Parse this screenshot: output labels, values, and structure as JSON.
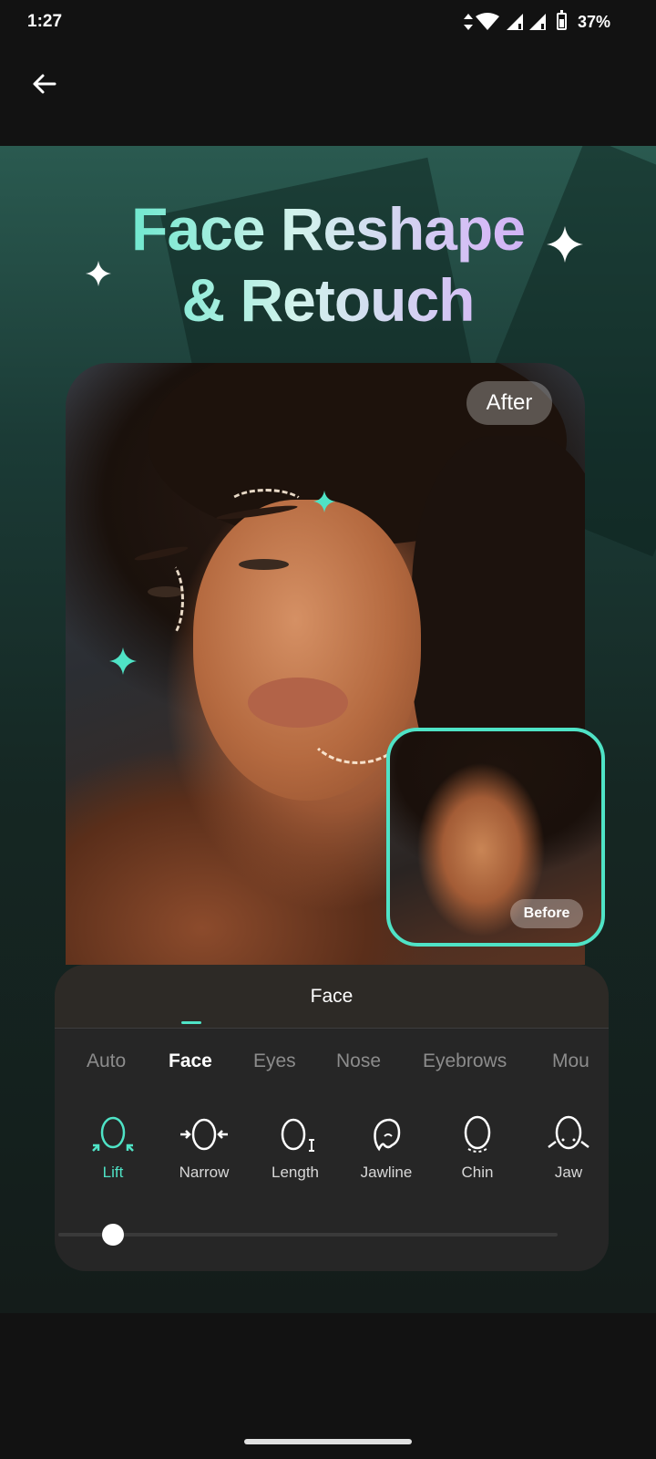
{
  "status_bar": {
    "time": "1:27",
    "battery_percent": "37%",
    "battery_level": 0.37,
    "icons": [
      "data-arrows-icon",
      "wifi-icon",
      "signal-icon",
      "signal-icon",
      "battery-icon"
    ]
  },
  "app_bar": {
    "back_icon": "arrow-left-icon"
  },
  "hero": {
    "title_line1": "Face Reshape",
    "title_line2": "& Retouch",
    "after_label": "After",
    "before_label": "Before"
  },
  "panel": {
    "header": "Face",
    "tabs": [
      {
        "label": "Auto",
        "active": false
      },
      {
        "label": "Face",
        "active": true
      },
      {
        "label": "Eyes",
        "active": false
      },
      {
        "label": "Nose",
        "active": false
      },
      {
        "label": "Eyebrows",
        "active": false
      },
      {
        "label": "Mou",
        "active": false
      }
    ],
    "tools": [
      {
        "label": "Lift",
        "icon": "face-lift-icon",
        "active": true
      },
      {
        "label": "Narrow",
        "icon": "face-narrow-icon",
        "active": false
      },
      {
        "label": "Length",
        "icon": "face-length-icon",
        "active": false
      },
      {
        "label": "Jawline",
        "icon": "jawline-icon",
        "active": false
      },
      {
        "label": "Chin",
        "icon": "chin-icon",
        "active": false
      },
      {
        "label": "Jaw",
        "icon": "jaw-icon",
        "active": false
      }
    ],
    "slider_value": 0
  },
  "colors": {
    "accent": "#4fe3c6",
    "panel_bg": "#262626",
    "background": "#121212"
  }
}
